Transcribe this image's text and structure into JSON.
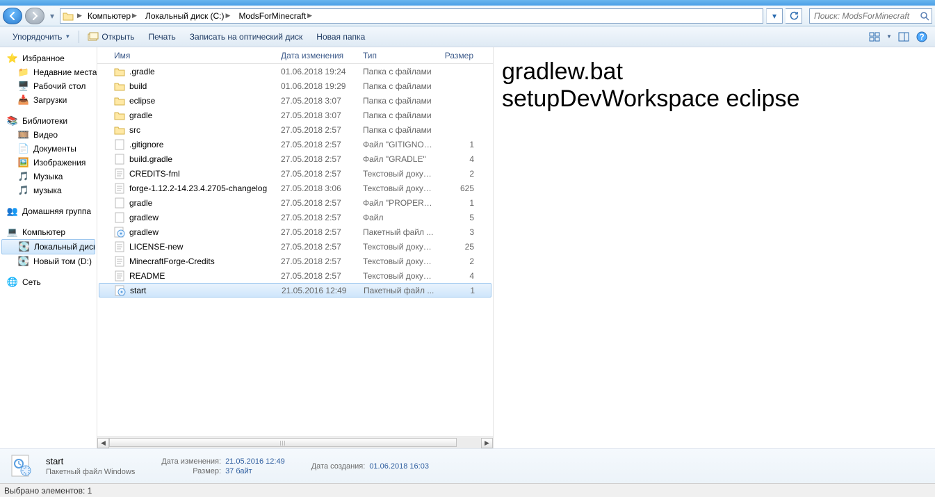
{
  "breadcrumb": {
    "segments": [
      "Компьютер",
      "Локальный диск (C:)",
      "ModsForMinecraft"
    ]
  },
  "search": {
    "placeholder": "Поиск: ModsForMinecraft"
  },
  "toolbar": {
    "organize": "Упорядочить",
    "open": "Открыть",
    "print": "Печать",
    "burn": "Записать на оптический диск",
    "newfolder": "Новая папка"
  },
  "columns": {
    "name": "Имя",
    "date": "Дата изменения",
    "type": "Тип",
    "size": "Размер"
  },
  "nav": {
    "favorites": "Избранное",
    "fav_items": [
      "Недавние места",
      "Рабочий стол",
      "Загрузки"
    ],
    "libraries": "Библиотеки",
    "lib_items": [
      "Видео",
      "Документы",
      "Изображения",
      "Музыка",
      "музыка"
    ],
    "homegroup": "Домашняя группа",
    "computer": "Компьютер",
    "comp_items": [
      "Локальный диск",
      "Новый том (D:)"
    ],
    "network": "Сеть"
  },
  "files": [
    {
      "icon": "folder",
      "name": ".gradle",
      "date": "01.06.2018 19:24",
      "type": "Папка с файлами",
      "size": ""
    },
    {
      "icon": "folder",
      "name": "build",
      "date": "01.06.2018 19:29",
      "type": "Папка с файлами",
      "size": ""
    },
    {
      "icon": "folder",
      "name": "eclipse",
      "date": "27.05.2018 3:07",
      "type": "Папка с файлами",
      "size": ""
    },
    {
      "icon": "folder",
      "name": "gradle",
      "date": "27.05.2018 3:07",
      "type": "Папка с файлами",
      "size": ""
    },
    {
      "icon": "folder",
      "name": "src",
      "date": "27.05.2018 2:57",
      "type": "Папка с файлами",
      "size": ""
    },
    {
      "icon": "file",
      "name": ".gitignore",
      "date": "27.05.2018 2:57",
      "type": "Файл \"GITIGNORE\"",
      "size": "1"
    },
    {
      "icon": "file",
      "name": "build.gradle",
      "date": "27.05.2018 2:57",
      "type": "Файл \"GRADLE\"",
      "size": "4"
    },
    {
      "icon": "text",
      "name": "CREDITS-fml",
      "date": "27.05.2018 2:57",
      "type": "Текстовый докум...",
      "size": "2"
    },
    {
      "icon": "text",
      "name": "forge-1.12.2-14.23.4.2705-changelog",
      "date": "27.05.2018 3:06",
      "type": "Текстовый докум...",
      "size": "625"
    },
    {
      "icon": "file",
      "name": "gradle",
      "date": "27.05.2018 2:57",
      "type": "Файл \"PROPERTIE...",
      "size": "1"
    },
    {
      "icon": "file",
      "name": "gradlew",
      "date": "27.05.2018 2:57",
      "type": "Файл",
      "size": "5"
    },
    {
      "icon": "bat",
      "name": "gradlew",
      "date": "27.05.2018 2:57",
      "type": "Пакетный файл ...",
      "size": "3"
    },
    {
      "icon": "text",
      "name": "LICENSE-new",
      "date": "27.05.2018 2:57",
      "type": "Текстовый докум...",
      "size": "25"
    },
    {
      "icon": "text",
      "name": "MinecraftForge-Credits",
      "date": "27.05.2018 2:57",
      "type": "Текстовый докум...",
      "size": "2"
    },
    {
      "icon": "text",
      "name": "README",
      "date": "27.05.2018 2:57",
      "type": "Текстовый докум...",
      "size": "4"
    },
    {
      "icon": "bat",
      "name": "start",
      "date": "21.05.2016 12:49",
      "type": "Пакетный файл ...",
      "size": "1",
      "selected": true
    }
  ],
  "preview": {
    "line1": "gradlew.bat",
    "line2": "setupDevWorkspace eclipse"
  },
  "details": {
    "name": "start",
    "type": "Пакетный файл Windows",
    "modified_label": "Дата изменения:",
    "modified": "21.05.2016 12:49",
    "size_label": "Размер:",
    "size": "37 байт",
    "created_label": "Дата создания:",
    "created": "01.06.2018 16:03"
  },
  "status": "Выбрано элементов: 1"
}
